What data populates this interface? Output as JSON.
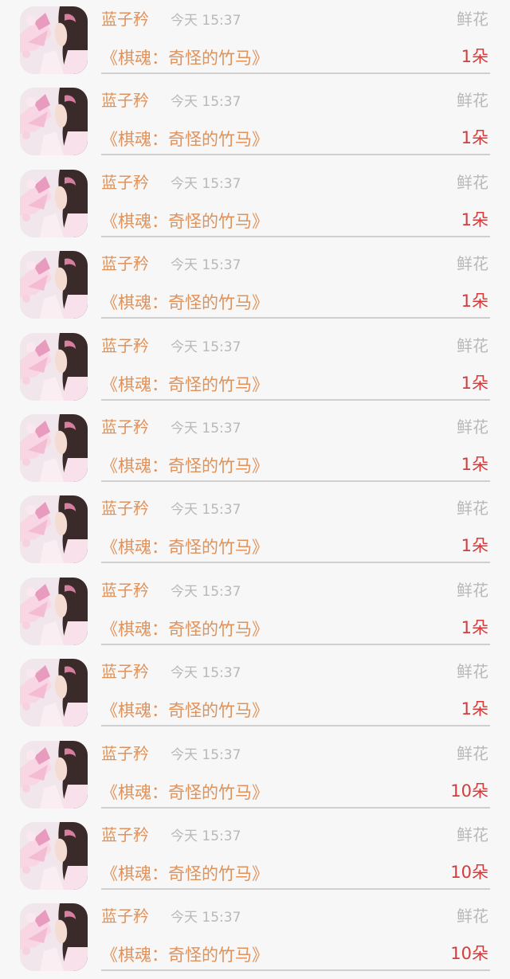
{
  "gift_records": [
    {
      "user_name": "蓝子矜",
      "time": "今天 15:37",
      "gift_type": "鲜花",
      "book_title": "《棋魂：奇怪的竹马》",
      "gift_count": "1朵"
    },
    {
      "user_name": "蓝子矜",
      "time": "今天 15:37",
      "gift_type": "鲜花",
      "book_title": "《棋魂：奇怪的竹马》",
      "gift_count": "1朵"
    },
    {
      "user_name": "蓝子矜",
      "time": "今天 15:37",
      "gift_type": "鲜花",
      "book_title": "《棋魂：奇怪的竹马》",
      "gift_count": "1朵"
    },
    {
      "user_name": "蓝子矜",
      "time": "今天 15:37",
      "gift_type": "鲜花",
      "book_title": "《棋魂：奇怪的竹马》",
      "gift_count": "1朵"
    },
    {
      "user_name": "蓝子矜",
      "time": "今天 15:37",
      "gift_type": "鲜花",
      "book_title": "《棋魂：奇怪的竹马》",
      "gift_count": "1朵"
    },
    {
      "user_name": "蓝子矜",
      "time": "今天 15:37",
      "gift_type": "鲜花",
      "book_title": "《棋魂：奇怪的竹马》",
      "gift_count": "1朵"
    },
    {
      "user_name": "蓝子矜",
      "time": "今天 15:37",
      "gift_type": "鲜花",
      "book_title": "《棋魂：奇怪的竹马》",
      "gift_count": "1朵"
    },
    {
      "user_name": "蓝子矜",
      "time": "今天 15:37",
      "gift_type": "鲜花",
      "book_title": "《棋魂：奇怪的竹马》",
      "gift_count": "1朵"
    },
    {
      "user_name": "蓝子矜",
      "time": "今天 15:37",
      "gift_type": "鲜花",
      "book_title": "《棋魂：奇怪的竹马》",
      "gift_count": "1朵"
    },
    {
      "user_name": "蓝子矜",
      "time": "今天 15:37",
      "gift_type": "鲜花",
      "book_title": "《棋魂：奇怪的竹马》",
      "gift_count": "10朵"
    },
    {
      "user_name": "蓝子矜",
      "time": "今天 15:37",
      "gift_type": "鲜花",
      "book_title": "《棋魂：奇怪的竹马》",
      "gift_count": "10朵"
    },
    {
      "user_name": "蓝子矜",
      "time": "今天 15:37",
      "gift_type": "鲜花",
      "book_title": "《棋魂：奇怪的竹马》",
      "gift_count": "10朵"
    }
  ],
  "colors": {
    "user_name": "#e0925a",
    "book_title": "#e0925a",
    "gift_count": "#d53b3b",
    "meta_text": "#b8b8b8",
    "background": "#f7f7f7",
    "divider": "#cfcfcf"
  },
  "icons": {
    "avatar": "user-avatar-photo"
  }
}
